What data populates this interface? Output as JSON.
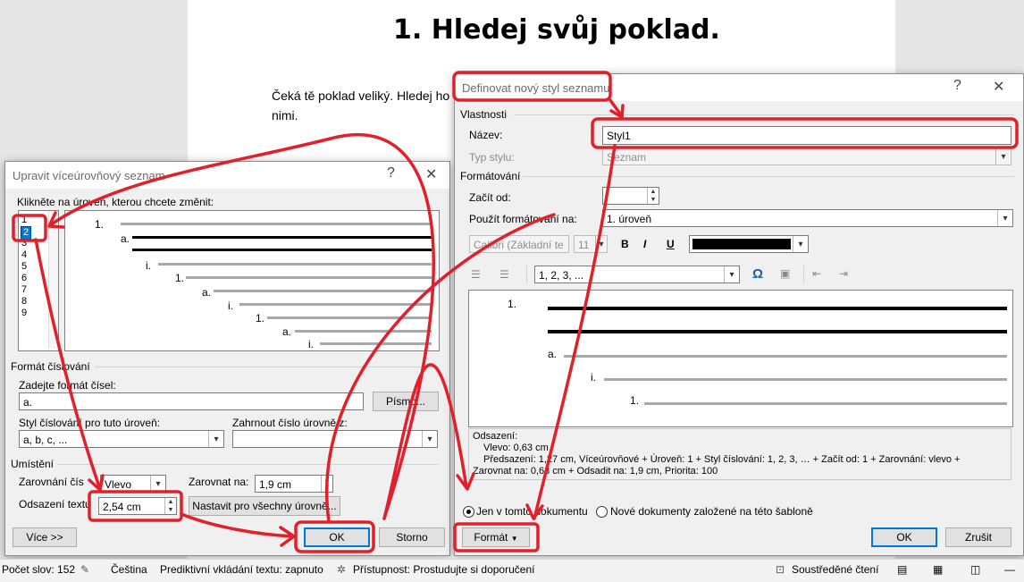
{
  "document": {
    "heading": "1.  Hledej svůj poklad.",
    "body_line1": "Čeká tě poklad veliký. Hledej ho p",
    "body_line2": "nimi."
  },
  "dialog_left": {
    "title": "Upravit víceúrovňový seznam",
    "help": "?",
    "close": "✕",
    "click_level_label": "Klikněte na úroveň, kterou chcete změnit:",
    "levels": [
      "1",
      "2",
      "3",
      "4",
      "5",
      "6",
      "7",
      "8",
      "9"
    ],
    "preview_numbers": [
      "1.",
      "a.",
      "i.",
      "1.",
      "a.",
      "i.",
      "1.",
      "a.",
      "i."
    ],
    "number_format_section": "Formát číslování",
    "enter_format_label": "Zadejte formát čísel:",
    "format_value": "a.",
    "font_button": "Písmo...",
    "numbering_style_label": "Styl číslování pro tuto úroveň:",
    "numbering_style_value": "a, b, c, ...",
    "include_level_label": "Zahrnout číslo úrovně z:",
    "include_level_value": "",
    "position_section": "Umístění",
    "alignment_label": "Zarovnání čís",
    "alignment_value": "Vlevo",
    "aligned_at_label": "Zarovnat na:",
    "aligned_at_value": "1,9 cm",
    "text_indent_label": "Odsazení textu",
    "text_indent_value": "2,54 cm",
    "set_all_button": "Nastavit pro všechny úrovně...",
    "more_button": "Více >>",
    "ok_button": "OK",
    "cancel_button": "Storno"
  },
  "dialog_right": {
    "title": "Definovat nový styl seznamu",
    "help": "?",
    "close": "✕",
    "properties_section": "Vlastnosti",
    "name_label": "Název:",
    "name_value": "Styl1",
    "style_type_label": "Typ stylu:",
    "style_type_value": "Seznam",
    "formatting_section": "Formátování",
    "start_at_label": "Začít od:",
    "start_at_value": "",
    "apply_to_label": "Použít formátování na:",
    "apply_to_value": "1. úroveň",
    "font_name": "Calibri (Základní te",
    "font_size": "11",
    "bold": "B",
    "italic": "I",
    "underline": "U",
    "number_style": "1, 2, 3, ...",
    "omega": "Ω",
    "preview_numbers": [
      "1.",
      "a.",
      "i.",
      "1."
    ],
    "description_title": "Odsazení:",
    "description_lines": [
      "Vlevo:  0,63 cm",
      "Předsazení:  1,27 cm, Víceúrovňové + Úroveň: 1 + Styl číslování: 1, 2, 3, … + Začít od: 1 + Zarovnání: vlevo +",
      "Zarovnat na:  0,63 cm + Odsadit na:  1,9 cm, Priorita: 100"
    ],
    "radio_this_doc": "Jen v tomto dokumentu",
    "radio_new_docs": "Nové dokumenty založené na této šabloně",
    "format_button": "Formát",
    "ok_button": "OK",
    "cancel_button": "Zrušit"
  },
  "statusbar": {
    "word_count": "Počet slov: 152",
    "language": "Čeština",
    "predictive": "Prediktivní vkládání textu: zapnuto",
    "accessibility": "Přístupnost: Prostudujte si doporučení",
    "focus": "Soustředěné čtení"
  },
  "colors": {
    "annotation_red": "#e0202a",
    "selection_blue": "#0078d7"
  }
}
